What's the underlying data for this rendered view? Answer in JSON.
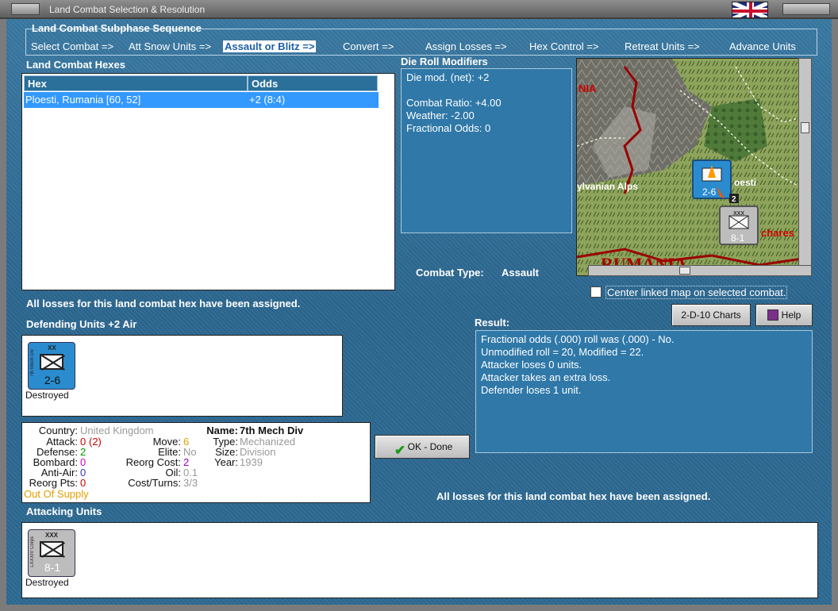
{
  "window": {
    "title": "Land Combat Selection & Resolution"
  },
  "subphase": {
    "heading": "Land Combat Subphase Sequence",
    "steps": [
      "Select Combat =>",
      "Att Snow Units =>",
      "Assault or Blitz =>",
      "Convert =>",
      "Assign Losses =>",
      "Hex Control =>",
      "Retreat Units =>",
      "Advance Units"
    ],
    "active_step": "Assault or Blitz =>"
  },
  "hexes": {
    "heading": "Land Combat Hexes",
    "columns": [
      "Hex",
      "Odds"
    ],
    "rows": [
      {
        "hex": "Ploesti, Rumania [60, 52]",
        "odds": "+2 (8:4)"
      }
    ]
  },
  "die_roll": {
    "heading": "Die Roll Modifiers",
    "net": "Die mod. (net): +2",
    "combat_ratio": "Combat Ratio: +4.00",
    "weather": "Weather: -2.00",
    "fractional": "Fractional Odds: 0"
  },
  "combat_type": {
    "label": "Combat Type:",
    "value": "Assault"
  },
  "map": {
    "labels": {
      "region_a": "NIA",
      "alps": "ylvanian Alps",
      "city": "oesti",
      "bucharest": "chares",
      "country": "RUMANIA"
    },
    "unit_top": {
      "strength": "2-6",
      "stack": "2"
    },
    "unit_bottom": {
      "size": "XXX",
      "strength": "8-1"
    },
    "center_label": "Center linked map on selected combat."
  },
  "status_top": "All losses for this land combat hex have been assigned.",
  "defending": {
    "heading": "Defending Units +2 Air",
    "units": [
      {
        "size": "XX",
        "strength": "2-6",
        "name": "7th Mech Div",
        "status": "Destroyed"
      }
    ]
  },
  "result": {
    "heading": "Result:",
    "lines": [
      "Fractional odds (.000) roll was (.000)  - No.",
      "Unmodified roll = 20, Modified = 22.",
      "Attacker loses 0 units.",
      "Attacker takes an extra loss.",
      "Defender loses 1 unit."
    ]
  },
  "buttons": {
    "charts": "2-D-10 Charts",
    "help": "Help",
    "ok": "OK - Done"
  },
  "unit_info": {
    "country_k": "Country:",
    "country_v": "United Kingdom",
    "attack_k": "Attack:",
    "attack_v": "0",
    "attack_extra": "(2)",
    "defense_k": "Defense:",
    "defense_v": "2",
    "bombard_k": "Bombard:",
    "bombard_v": "0",
    "antiair_k": "Anti-Air:",
    "antiair_v": "0",
    "reorg_k": "Reorg Pts:",
    "reorg_v": "0",
    "supply": "Out Of Supply",
    "move_k": "Move:",
    "move_v": "6",
    "elite_k": "Elite:",
    "elite_v": "No",
    "reorgcost_k": "Reorg Cost:",
    "reorgcost_v": "2",
    "oil_k": "Oil:",
    "oil_v": "0.1",
    "costturns_k": "Cost/Turns:",
    "costturns_v": "3/3",
    "name_k": "Name:",
    "name_v": "7th Mech Div",
    "type_k": "Type:",
    "type_v": "Mechanized",
    "size_k": "Size:",
    "size_v": "Division",
    "year_k": "Year:",
    "year_v": "1939"
  },
  "status_bottom": "All losses for this land combat hex have been assigned.",
  "attacking": {
    "heading": "Attacking Units",
    "units": [
      {
        "size": "XXX",
        "strength": "8-1",
        "name": "LXXXIV Corps",
        "status": "Destroyed"
      }
    ]
  },
  "colors": {
    "accent_blue": "#3399ff",
    "panel": "#2f78a8",
    "red": "#cc0000",
    "green": "#009900",
    "orange": "#e0a000",
    "purple": "#9900cc"
  }
}
